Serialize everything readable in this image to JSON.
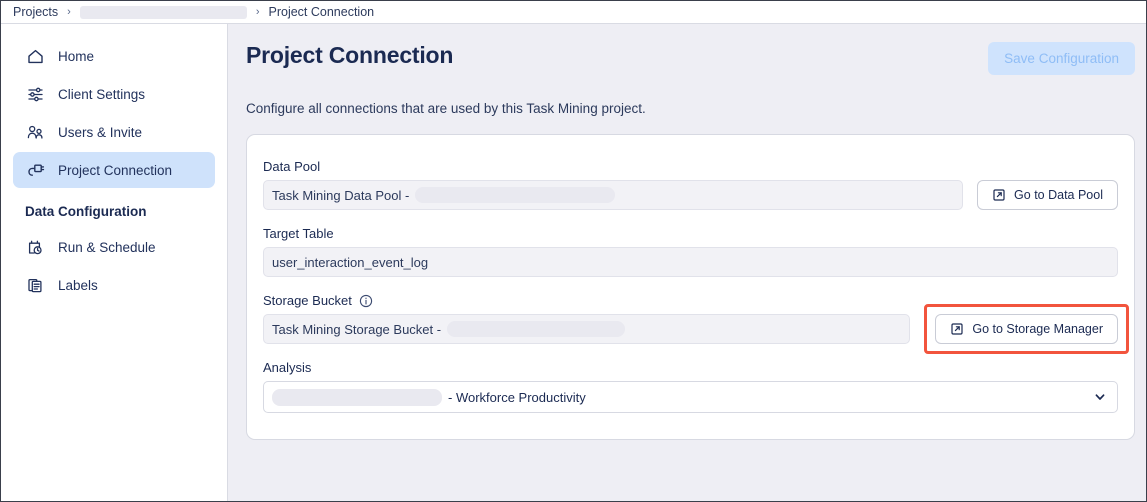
{
  "breadcrumb": {
    "root": "Projects",
    "separator": "›",
    "redacted_project": "",
    "current": "Project Connection"
  },
  "sidebar": {
    "items": [
      {
        "label": "Home",
        "icon": "home-icon",
        "active": false
      },
      {
        "label": "Client Settings",
        "icon": "sliders-icon",
        "active": false
      },
      {
        "label": "Users & Invite",
        "icon": "users-icon",
        "active": false
      },
      {
        "label": "Project Connection",
        "icon": "connection-plug-icon",
        "active": true
      }
    ],
    "section_title": "Data Configuration",
    "section_items": [
      {
        "label": "Run & Schedule",
        "icon": "calendar-clock-icon"
      },
      {
        "label": "Labels",
        "icon": "documents-icon"
      }
    ]
  },
  "page": {
    "title": "Project Connection",
    "description": "Configure all connections that are used by this Task Mining project.",
    "save_label": "Save Configuration"
  },
  "form": {
    "data_pool": {
      "label": "Data Pool",
      "value": "Task Mining Data Pool -",
      "button_label": "Go to Data Pool",
      "button_icon": "external-link-icon"
    },
    "target_table": {
      "label": "Target Table",
      "value": "user_interaction_event_log"
    },
    "storage_bucket": {
      "label": "Storage Bucket",
      "info_icon": "info-circle-icon",
      "value": "Task Mining Storage Bucket -",
      "button_label": "Go to Storage Manager",
      "button_icon": "external-link-icon",
      "highlighted": true
    },
    "analysis": {
      "label": "Analysis",
      "value": "- Workforce Productivity",
      "chevron_icon": "chevron-down-icon"
    }
  },
  "colors": {
    "accent_blue": "#cfe2fb",
    "highlight_red": "#f2543d",
    "page_background": "#eeeef4",
    "text_navy": "#1b2a52",
    "disabled_button_bg": "#cfe3fd",
    "disabled_button_text": "#8fbdf6"
  }
}
